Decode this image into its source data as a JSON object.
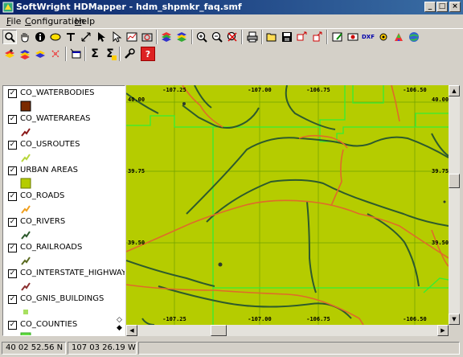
{
  "window": {
    "title": "SoftWright HDMapper - hdm_shpmkr_faq.smf"
  },
  "menu": [
    {
      "label": "File",
      "mnemonic": "F",
      "rest": "ile"
    },
    {
      "label": "Configuration",
      "mnemonic": "C",
      "rest": "onfiguration"
    },
    {
      "label": "Help",
      "mnemonic": "H",
      "rest": "elp"
    }
  ],
  "toolbar_row1": [
    "zoom-tool-icon",
    "pan-hand-icon",
    "info-icon",
    "label-icon",
    "text-tool-icon",
    "measure-line-icon",
    "select-arrow-icon",
    "edit-arrow-icon",
    "chart-icon",
    "refresh-map-icon",
    "layers-icon",
    "layers-alt-icon",
    "zoom-in-icon",
    "zoom-out-icon",
    "zoom-full-icon",
    "print-icon",
    "open-folder-icon",
    "save-icon",
    "export-icon",
    "export-alt-icon",
    "edit-table-icon",
    "record-icon",
    "dxf-icon",
    "settings-icon",
    "palette-icon",
    "globe-icon"
  ],
  "toolbar_row2": [
    "add-layer-icon",
    "layer-stack-icon",
    "layer-edit-icon",
    "points-icon",
    "new-window-icon",
    "sum-icon",
    "sum-select-icon",
    "wrench-icon",
    "help-icon"
  ],
  "toolbar_text": {
    "dxf": "DXF",
    "sum": "Σ",
    "help": "?"
  },
  "layers": [
    {
      "name": "CO_WATERBODIES",
      "checked": true,
      "symbol": "fill",
      "color": "#7a2a00"
    },
    {
      "name": "CO_WATERAREAS",
      "checked": true,
      "symbol": "line",
      "color": "#8b1a1a"
    },
    {
      "name": "CO_USROUTES",
      "checked": true,
      "symbol": "line",
      "color": "#b7d63a"
    },
    {
      "name": "URBAN AREAS",
      "checked": true,
      "symbol": "fill",
      "color": "#b5cc00"
    },
    {
      "name": "CO_ROADS",
      "checked": true,
      "symbol": "line",
      "color": "#f0a020"
    },
    {
      "name": "CO_RIVERS",
      "checked": true,
      "symbol": "line",
      "color": "#2d5a2d"
    },
    {
      "name": "CO_RAILROADS",
      "checked": true,
      "symbol": "line",
      "color": "#5a6a20"
    },
    {
      "name": "CO_INTERSTATE_HIGHWAY",
      "checked": true,
      "symbol": "line",
      "color": "#8b3030"
    },
    {
      "name": "CO_GNIS_BUILDINGS",
      "checked": true,
      "symbol": "dot",
      "color": "#a8e060"
    },
    {
      "name": "CO_COUNTIES",
      "checked": true,
      "symbol": "fill",
      "color": "#66dd44"
    }
  ],
  "map": {
    "background": "#b5cc00",
    "lon_labels": [
      "-107.25",
      "-107.00",
      "-106.75",
      "-106.50"
    ],
    "lat_labels": [
      "40.00",
      "39.75",
      "39.50"
    ],
    "colors": {
      "river": "#2d5a2d",
      "road": "#e06a2a",
      "county": "#33ee33",
      "grid": "#6fa000"
    }
  },
  "status": {
    "latitude": "40 02 52.56 N",
    "longitude": "107 03 26.19 W"
  }
}
